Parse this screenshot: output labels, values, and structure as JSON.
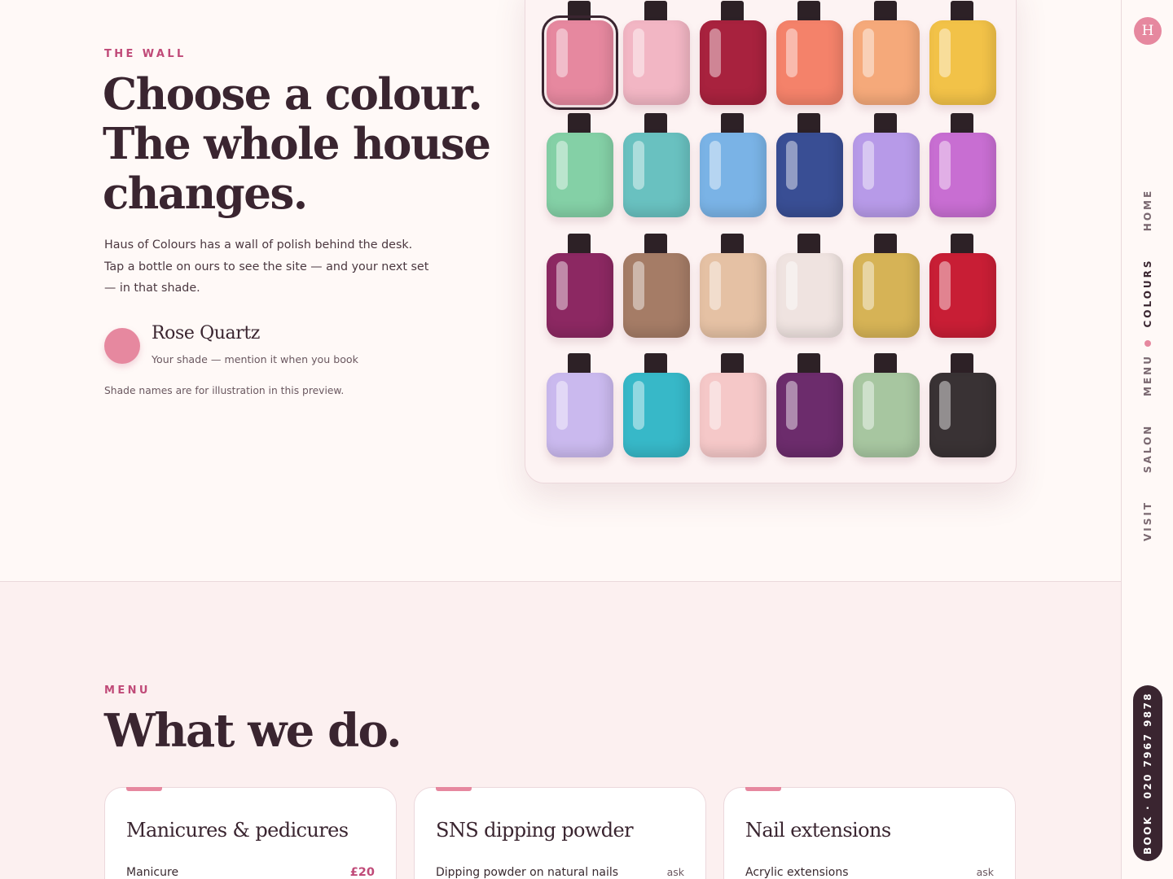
{
  "hero": {
    "eyebrow": "THE WALL",
    "title": "Choose a colour.\nThe whole house\nchanges.",
    "description": "Haus of Colours has a wall of polish behind the desk.\nTap a bottle on ours to see the site — and your next set\n— in that shade.",
    "selected_shade": {
      "name": "Rose Quartz",
      "subtitle": "Your shade — mention it when you book",
      "color": "#e6889f"
    },
    "note": "Shade names are for illustration in this preview."
  },
  "wall": {
    "selected_index": 0,
    "bottles": [
      "#e6889f",
      "#f2b6c4",
      "#a8223e",
      "#f4826a",
      "#f5a97a",
      "#f2c248",
      "#84d0a6",
      "#69c1c0",
      "#7ab3e6",
      "#394e94",
      "#b79ae8",
      "#c86ed2",
      "#8c2862",
      "#a57c66",
      "#e5c1a4",
      "#efe3e0",
      "#d6b356",
      "#c81e35",
      "#cab9ee",
      "#37b8c8",
      "#f5c8c8",
      "#6c2c6c",
      "#a7c6a0",
      "#393234"
    ]
  },
  "menu": {
    "eyebrow": "MENU",
    "title": "What we do.",
    "cards": [
      {
        "title": "Manicures & pedicures",
        "item": "Manicure",
        "price": "£20",
        "ask": ""
      },
      {
        "title": "SNS dipping powder",
        "item": "Dipping powder on natural nails",
        "price": "",
        "ask": "ask"
      },
      {
        "title": "Nail extensions",
        "item": "Acrylic extensions",
        "price": "",
        "ask": "ask"
      }
    ]
  },
  "rail": {
    "logo": "H",
    "nav": [
      "HOME",
      "COLOURS",
      "MENU",
      "SALON",
      "VISIT"
    ],
    "active": "COLOURS",
    "book": "BOOK · 020 7967 9878",
    "accent": "#e6889f"
  }
}
